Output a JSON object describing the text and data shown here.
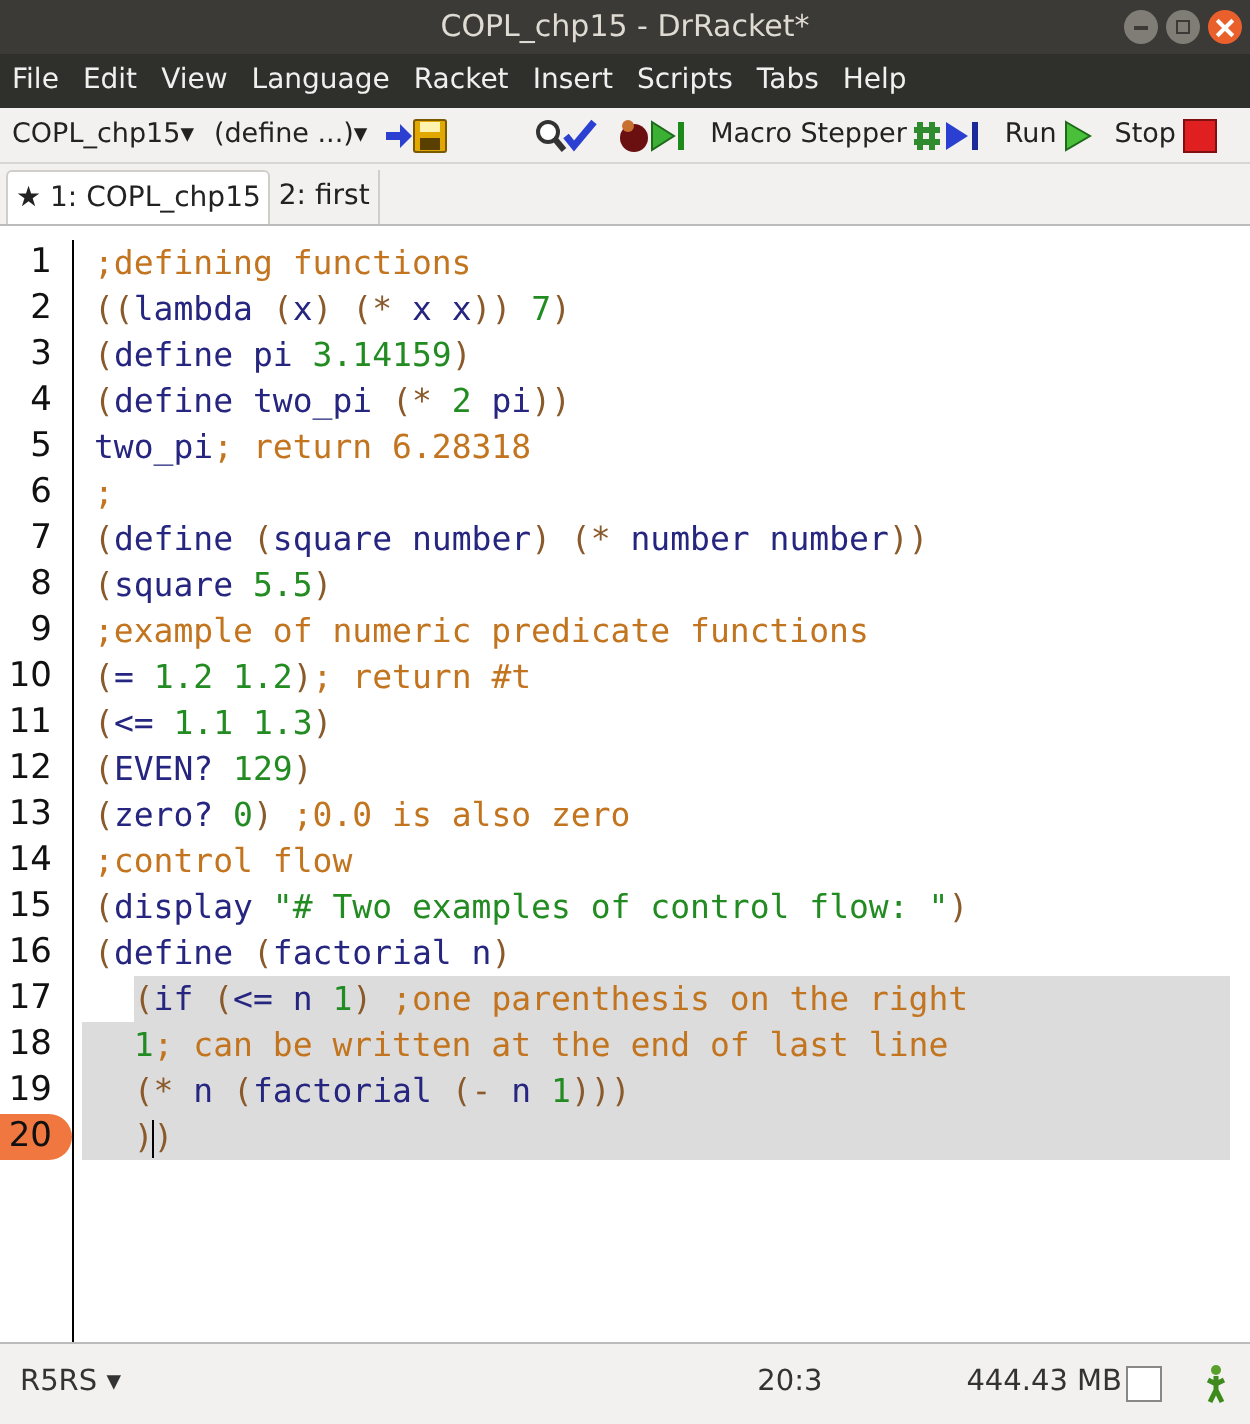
{
  "window": {
    "title": "COPL_chp15 - DrRacket*"
  },
  "menu": [
    "File",
    "Edit",
    "View",
    "Language",
    "Racket",
    "Insert",
    "Scripts",
    "Tabs",
    "Help"
  ],
  "toolbar": {
    "file_menu": "COPL_chp15▾",
    "define_menu": "(define ...)▾",
    "buttons": [
      {
        "kind": "save"
      },
      {
        "kind": "check"
      },
      {
        "kind": "debug"
      },
      {
        "kind": "macro",
        "label": "Macro Stepper"
      },
      {
        "kind": "run",
        "label": "Run"
      },
      {
        "kind": "stop",
        "label": "Stop"
      }
    ]
  },
  "tabs": [
    {
      "label": "★ 1: COPL_chp15",
      "selected": true
    },
    {
      "label": "2: first",
      "selected": false
    }
  ],
  "editor": {
    "lines": [
      {
        "number": "1",
        "current": false,
        "highlighted": false,
        "indent": false,
        "tokens": [
          {
            "kind": "comment",
            "text": ";defining functions"
          }
        ]
      },
      {
        "number": "2",
        "current": false,
        "highlighted": false,
        "indent": false,
        "tokens": [
          {
            "kind": "paren",
            "text": "(("
          },
          {
            "kind": "symbol",
            "text": "lambda "
          },
          {
            "kind": "paren",
            "text": "("
          },
          {
            "kind": "symbol",
            "text": "x"
          },
          {
            "kind": "paren",
            "text": ") (* "
          },
          {
            "kind": "symbol",
            "text": "x x"
          },
          {
            "kind": "paren",
            "text": ")) "
          },
          {
            "kind": "number",
            "text": "7"
          },
          {
            "kind": "paren",
            "text": ")"
          }
        ]
      },
      {
        "number": "3",
        "current": false,
        "highlighted": false,
        "indent": false,
        "tokens": [
          {
            "kind": "paren",
            "text": "("
          },
          {
            "kind": "symbol",
            "text": "define pi "
          },
          {
            "kind": "number",
            "text": "3.14159"
          },
          {
            "kind": "paren",
            "text": ")"
          }
        ]
      },
      {
        "number": "4",
        "current": false,
        "highlighted": false,
        "indent": false,
        "tokens": [
          {
            "kind": "paren",
            "text": "("
          },
          {
            "kind": "symbol",
            "text": "define two_pi "
          },
          {
            "kind": "paren",
            "text": "(* "
          },
          {
            "kind": "number",
            "text": "2"
          },
          {
            "kind": "symbol",
            "text": " pi"
          },
          {
            "kind": "paren",
            "text": "))"
          }
        ]
      },
      {
        "number": "5",
        "current": false,
        "highlighted": false,
        "indent": false,
        "tokens": [
          {
            "kind": "symbol",
            "text": "two_pi"
          },
          {
            "kind": "comment",
            "text": "; return 6.28318"
          }
        ]
      },
      {
        "number": "6",
        "current": false,
        "highlighted": false,
        "indent": false,
        "tokens": [
          {
            "kind": "comment",
            "text": ";"
          }
        ]
      },
      {
        "number": "7",
        "current": false,
        "highlighted": false,
        "indent": false,
        "tokens": [
          {
            "kind": "paren",
            "text": "("
          },
          {
            "kind": "symbol",
            "text": "define "
          },
          {
            "kind": "paren",
            "text": "("
          },
          {
            "kind": "symbol",
            "text": "square number"
          },
          {
            "kind": "paren",
            "text": ") (* "
          },
          {
            "kind": "symbol",
            "text": "number number"
          },
          {
            "kind": "paren",
            "text": "))"
          }
        ]
      },
      {
        "number": "8",
        "current": false,
        "highlighted": false,
        "indent": false,
        "tokens": [
          {
            "kind": "paren",
            "text": "("
          },
          {
            "kind": "symbol",
            "text": "square "
          },
          {
            "kind": "number",
            "text": "5.5"
          },
          {
            "kind": "paren",
            "text": ")"
          }
        ]
      },
      {
        "number": "9",
        "current": false,
        "highlighted": false,
        "indent": false,
        "tokens": [
          {
            "kind": "comment",
            "text": ";example of numeric predicate functions"
          }
        ]
      },
      {
        "number": "10",
        "current": false,
        "highlighted": false,
        "indent": false,
        "tokens": [
          {
            "kind": "paren",
            "text": "("
          },
          {
            "kind": "symbol",
            "text": "= "
          },
          {
            "kind": "number",
            "text": "1.2 1.2"
          },
          {
            "kind": "paren",
            "text": ")"
          },
          {
            "kind": "comment",
            "text": "; return #t"
          }
        ]
      },
      {
        "number": "11",
        "current": false,
        "highlighted": false,
        "indent": false,
        "tokens": [
          {
            "kind": "paren",
            "text": "("
          },
          {
            "kind": "symbol",
            "text": "<= "
          },
          {
            "kind": "number",
            "text": "1.1 1.3"
          },
          {
            "kind": "paren",
            "text": ")"
          }
        ]
      },
      {
        "number": "12",
        "current": false,
        "highlighted": false,
        "indent": false,
        "tokens": [
          {
            "kind": "paren",
            "text": "("
          },
          {
            "kind": "symbol",
            "text": "EVEN? "
          },
          {
            "kind": "number",
            "text": "129"
          },
          {
            "kind": "paren",
            "text": ")"
          }
        ]
      },
      {
        "number": "13",
        "current": false,
        "highlighted": false,
        "indent": false,
        "tokens": [
          {
            "kind": "paren",
            "text": "("
          },
          {
            "kind": "symbol",
            "text": "zero? "
          },
          {
            "kind": "number",
            "text": "0"
          },
          {
            "kind": "paren",
            "text": ") "
          },
          {
            "kind": "comment",
            "text": ";0.0 is also zero"
          }
        ]
      },
      {
        "number": "14",
        "current": false,
        "highlighted": false,
        "indent": false,
        "tokens": [
          {
            "kind": "comment",
            "text": ";control flow"
          }
        ]
      },
      {
        "number": "15",
        "current": false,
        "highlighted": false,
        "indent": false,
        "tokens": [
          {
            "kind": "paren",
            "text": "("
          },
          {
            "kind": "symbol",
            "text": "display "
          },
          {
            "kind": "string",
            "text": "\"# Two examples of control flow: \""
          },
          {
            "kind": "paren",
            "text": ")"
          }
        ]
      },
      {
        "number": "16",
        "current": false,
        "highlighted": false,
        "indent": false,
        "tokens": [
          {
            "kind": "paren",
            "text": "("
          },
          {
            "kind": "symbol",
            "text": "define "
          },
          {
            "kind": "paren",
            "text": "("
          },
          {
            "kind": "symbol",
            "text": "factorial n"
          },
          {
            "kind": "paren",
            "text": ")"
          }
        ]
      },
      {
        "number": "17",
        "current": false,
        "highlighted": true,
        "indent": true,
        "tokens": [
          {
            "kind": "paren",
            "text": "("
          },
          {
            "kind": "symbol",
            "text": "if "
          },
          {
            "kind": "paren",
            "text": "("
          },
          {
            "kind": "symbol",
            "text": "<= n "
          },
          {
            "kind": "number",
            "text": "1"
          },
          {
            "kind": "paren",
            "text": ") "
          },
          {
            "kind": "comment",
            "text": ";one parenthesis on the right"
          }
        ]
      },
      {
        "number": "18",
        "current": false,
        "highlighted": true,
        "indent": true,
        "tokens": [
          {
            "kind": "number",
            "text": "1"
          },
          {
            "kind": "comment",
            "text": "; can be written at the end of last line"
          }
        ]
      },
      {
        "number": "19",
        "current": false,
        "highlighted": true,
        "indent": true,
        "tokens": [
          {
            "kind": "paren",
            "text": "(* "
          },
          {
            "kind": "symbol",
            "text": "n "
          },
          {
            "kind": "paren",
            "text": "("
          },
          {
            "kind": "symbol",
            "text": "factorial "
          },
          {
            "kind": "paren",
            "text": "(- "
          },
          {
            "kind": "symbol",
            "text": "n "
          },
          {
            "kind": "number",
            "text": "1"
          },
          {
            "kind": "paren",
            "text": ")))"
          }
        ]
      },
      {
        "number": "20",
        "current": true,
        "highlighted": true,
        "indent": true,
        "tokens": [
          {
            "kind": "paren",
            "text": ")"
          },
          {
            "kind": "cursor"
          },
          {
            "kind": "paren",
            "text": ")"
          }
        ]
      }
    ]
  },
  "status": {
    "language": "R5RS ▾",
    "position": "20:3",
    "memory": "444.43 MB"
  }
}
